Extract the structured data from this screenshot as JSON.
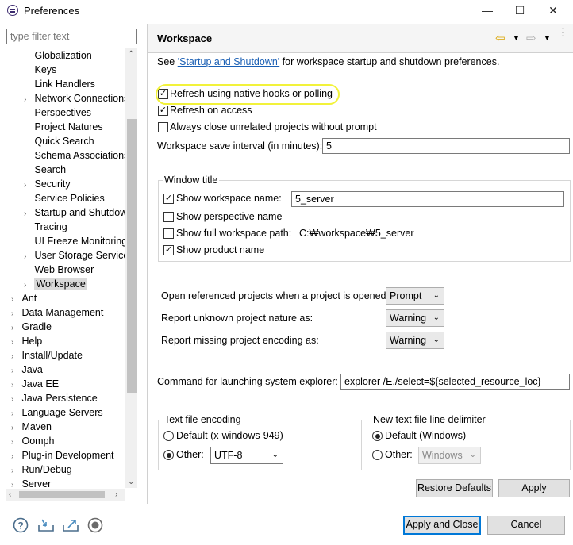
{
  "window": {
    "title": "Preferences",
    "minimize": "—",
    "maximize": "☐",
    "close": "✕"
  },
  "filter": {
    "placeholder": "type filter text"
  },
  "tree": {
    "items": [
      {
        "label": "Globalization",
        "expandable": false,
        "level": 1
      },
      {
        "label": "Keys",
        "expandable": false,
        "level": 1
      },
      {
        "label": "Link Handlers",
        "expandable": false,
        "level": 1
      },
      {
        "label": "Network Connections",
        "expandable": true,
        "level": 1
      },
      {
        "label": "Perspectives",
        "expandable": false,
        "level": 1
      },
      {
        "label": "Project Natures",
        "expandable": false,
        "level": 1
      },
      {
        "label": "Quick Search",
        "expandable": false,
        "level": 1
      },
      {
        "label": "Schema Associations",
        "expandable": false,
        "level": 1
      },
      {
        "label": "Search",
        "expandable": false,
        "level": 1
      },
      {
        "label": "Security",
        "expandable": true,
        "level": 1
      },
      {
        "label": "Service Policies",
        "expandable": false,
        "level": 1
      },
      {
        "label": "Startup and Shutdown",
        "expandable": true,
        "level": 1
      },
      {
        "label": "Tracing",
        "expandable": false,
        "level": 1
      },
      {
        "label": "UI Freeze Monitoring",
        "expandable": false,
        "level": 1
      },
      {
        "label": "User Storage Service",
        "expandable": true,
        "level": 1
      },
      {
        "label": "Web Browser",
        "expandable": false,
        "level": 1
      },
      {
        "label": "Workspace",
        "expandable": true,
        "level": 1,
        "selected": true
      },
      {
        "label": "Ant",
        "expandable": true,
        "level": 0
      },
      {
        "label": "Data Management",
        "expandable": true,
        "level": 0
      },
      {
        "label": "Gradle",
        "expandable": true,
        "level": 0
      },
      {
        "label": "Help",
        "expandable": true,
        "level": 0
      },
      {
        "label": "Install/Update",
        "expandable": true,
        "level": 0
      },
      {
        "label": "Java",
        "expandable": true,
        "level": 0
      },
      {
        "label": "Java EE",
        "expandable": true,
        "level": 0
      },
      {
        "label": "Java Persistence",
        "expandable": true,
        "level": 0
      },
      {
        "label": "Language Servers",
        "expandable": true,
        "level": 0
      },
      {
        "label": "Maven",
        "expandable": true,
        "level": 0
      },
      {
        "label": "Oomph",
        "expandable": true,
        "level": 0
      },
      {
        "label": "Plug-in Development",
        "expandable": true,
        "level": 0
      },
      {
        "label": "Run/Debug",
        "expandable": true,
        "level": 0
      },
      {
        "label": "Server",
        "expandable": true,
        "level": 0
      }
    ]
  },
  "page": {
    "title": "Workspace",
    "see_prefix": "See ",
    "see_link": "'Startup and Shutdown'",
    "see_suffix": " for workspace startup and shutdown preferences.",
    "refresh_native": {
      "label": "Refresh using native hooks or polling",
      "checked": true
    },
    "refresh_access": {
      "label": "Refresh on access",
      "checked": true
    },
    "always_close": {
      "label": "Always close unrelated projects without prompt",
      "checked": false
    },
    "save_interval_label": "Workspace save interval (in minutes):",
    "save_interval_value": "5",
    "window_title": {
      "group_label": "Window title",
      "show_ws_name": {
        "label": "Show workspace name:",
        "checked": true,
        "value": "5_server"
      },
      "show_perspective": {
        "label": "Show perspective name",
        "checked": false
      },
      "show_full_path": {
        "label": "Show full workspace path:",
        "checked": false,
        "value": "C:₩workspace₩5_server"
      },
      "show_product": {
        "label": "Show product name",
        "checked": true
      }
    },
    "open_ref_label": "Open referenced projects when a project is opened:",
    "open_ref_value": "Prompt",
    "unknown_nature_label": "Report unknown project nature as:",
    "unknown_nature_value": "Warning",
    "missing_encoding_label": "Report missing project encoding as:",
    "missing_encoding_value": "Warning",
    "explorer_label": "Command for launching system explorer:",
    "explorer_value": "explorer /E,/select=${selected_resource_loc}",
    "text_encoding": {
      "group_label": "Text file encoding",
      "default_label": "Default (x-windows-949)",
      "other_label": "Other:",
      "other_value": "UTF-8"
    },
    "line_delim": {
      "group_label": "New text file line delimiter",
      "default_label": "Default (Windows)",
      "other_label": "Other:",
      "other_value": "Windows"
    },
    "restore_defaults": "Restore Defaults",
    "apply": "Apply"
  },
  "footer": {
    "apply_close": "Apply and Close",
    "cancel": "Cancel"
  }
}
